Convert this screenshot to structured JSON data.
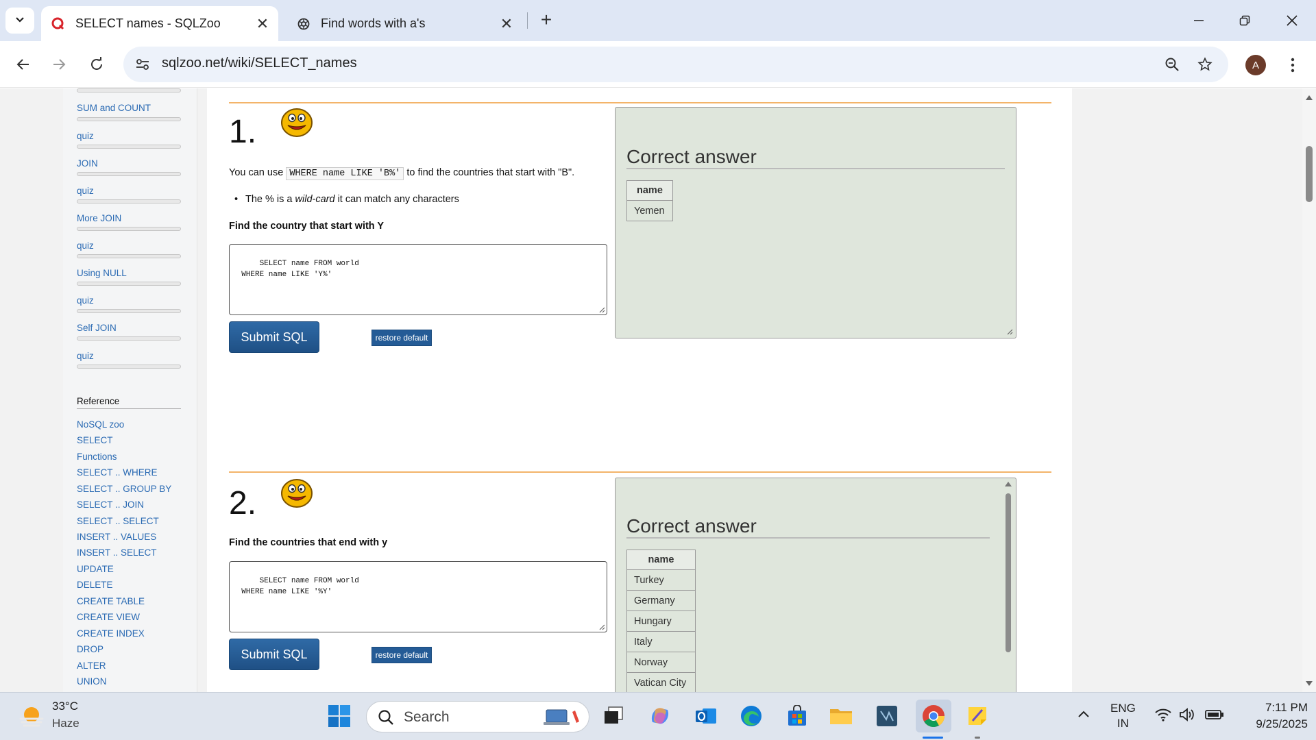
{
  "browser": {
    "tabs": [
      {
        "title": "SELECT names - SQLZoo",
        "active": true
      },
      {
        "title": "Find words with a's",
        "active": false
      }
    ],
    "url": "sqlzoo.net/wiki/SELECT_names",
    "profile_initial": "A"
  },
  "sidebar": {
    "items": [
      "SUM and COUNT",
      "quiz",
      "JOIN",
      "quiz",
      "More JOIN",
      "quiz",
      "Using NULL",
      "quiz",
      "Self JOIN",
      "quiz"
    ],
    "reference_heading": "Reference",
    "reference_links": [
      "NoSQL zoo",
      "SELECT",
      "Functions",
      "SELECT .. WHERE",
      "SELECT .. GROUP BY",
      "SELECT .. JOIN",
      "SELECT .. SELECT",
      "INSERT .. VALUES",
      "INSERT .. SELECT",
      "UPDATE",
      "DELETE",
      "CREATE TABLE",
      "CREATE VIEW",
      "CREATE INDEX",
      "DROP",
      "ALTER",
      "UNION"
    ]
  },
  "q1": {
    "number": "1.",
    "intro_before": "You can use ",
    "intro_code": "WHERE name LIKE 'B%'",
    "intro_after": " to find the countries that start with \"B\".",
    "bullet_before": "The % is a ",
    "bullet_em": "wild-card",
    "bullet_after": " it can match any characters",
    "task": "Find the country that start with Y",
    "sql": "SELECT name FROM world\n  WHERE name LIKE 'Y%'",
    "submit": "Submit SQL",
    "restore": "restore default",
    "answer_title": "Correct answer",
    "answer_header": "name",
    "answer_rows": [
      "Yemen"
    ]
  },
  "q2": {
    "number": "2.",
    "task": "Find the countries that end with y",
    "sql": "SELECT name FROM world\n  WHERE name LIKE '%Y'",
    "submit": "Submit SQL",
    "restore": "restore default",
    "answer_title": "Correct answer",
    "answer_header": "name",
    "answer_rows": [
      "Turkey",
      "Germany",
      "Hungary",
      "Italy",
      "Norway",
      "Vatican City"
    ]
  },
  "taskbar": {
    "temperature": "33°C",
    "condition": "Haze",
    "search_placeholder": "Search",
    "language": "ENG",
    "region": "IN",
    "time": "7:11 PM",
    "date": "9/25/2025"
  }
}
